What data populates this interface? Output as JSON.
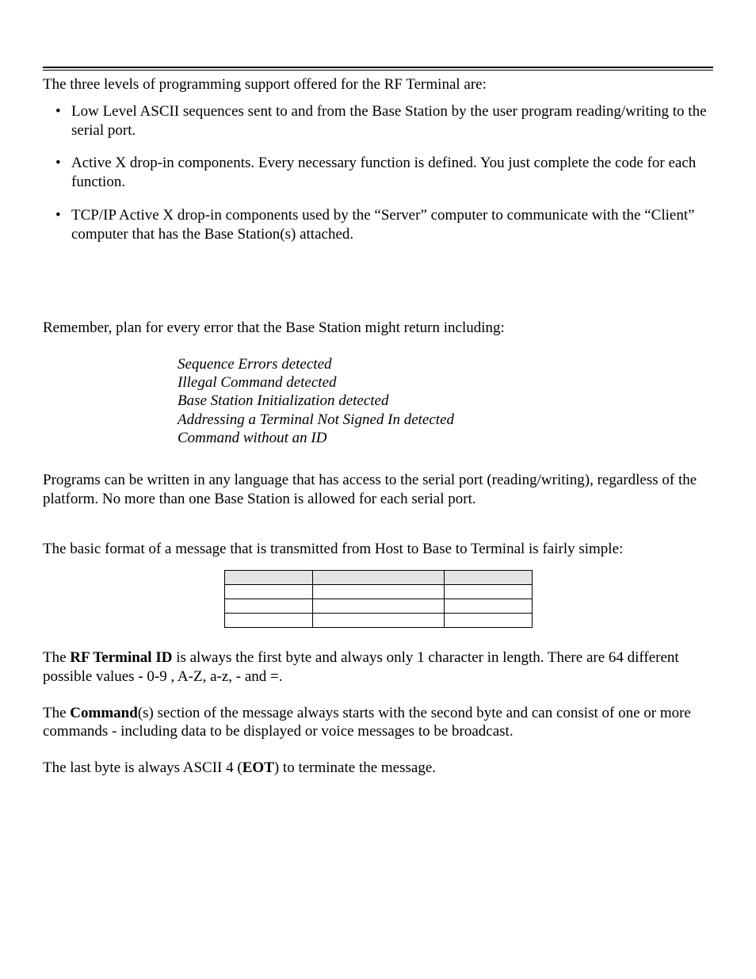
{
  "intro": "The three levels of programming support offered for the RF Terminal are:",
  "bullets": [
    "Low Level ASCII sequences sent to and from the Base Station by the user program reading/writing to the serial port.",
    "Active X drop-in components. Every necessary function is defined. You just complete the code for each function.",
    "TCP/IP Active X drop-in components used by the “Server” computer to communicate with the “Client” computer that has the Base Station(s) attached."
  ],
  "remember_intro": "Remember, plan for every error that the Base Station might return including:",
  "errors": [
    "Sequence Errors detected",
    "Illegal Command detected",
    "Base Station Initialization detected",
    "Addressing a Terminal Not Signed In detected",
    "Command without an ID"
  ],
  "programs_para": "Programs can be written in any language that has access to the serial port (reading/writing), regardless of the platform. No more than one Base Station is allowed for each serial port.",
  "format_intro": "The basic format of a message that is transmitted from Host to Base to Terminal is fairly simple:",
  "rfid": {
    "prefix": "The ",
    "bold": "RF Terminal ID",
    "suffix": " is always the first byte and always only 1 character in length. There are 64 different possible values - 0-9 , A-Z, a-z, - and =."
  },
  "command": {
    "prefix": "The ",
    "bold": "Command",
    "suffix": "(s) section of the message always starts with the second byte and can consist of one or more commands - including data to be displayed or voice messages to be broadcast."
  },
  "eot": {
    "prefix": "The last byte is always ASCII 4 (",
    "bold": "EOT",
    "suffix": ") to terminate the message."
  }
}
